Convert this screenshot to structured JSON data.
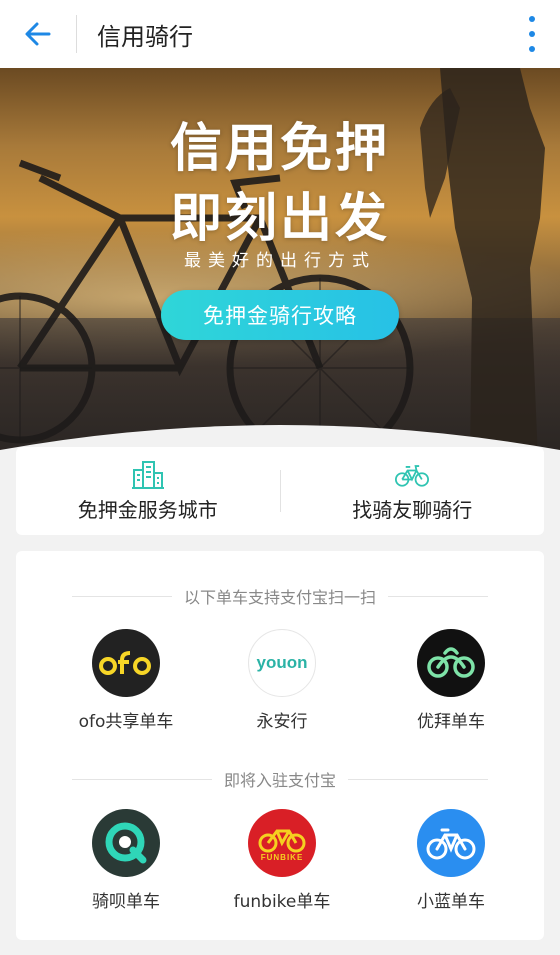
{
  "header": {
    "title": "信用骑行",
    "back_icon": "arrow-left-icon",
    "more_icon": "more-vertical-icon",
    "accent": "#1e88e5"
  },
  "banner": {
    "title_line1": "信用免押",
    "title_line2": "即刻出发",
    "subtitle": "最美好的出行方式",
    "button_label": "免押金骑行攻略",
    "button_color": "#2fd6d8"
  },
  "quick_links": [
    {
      "label": "免押金服务城市",
      "icon": "city-buildings-icon"
    },
    {
      "label": "找骑友聊骑行",
      "icon": "bicycle-icon"
    }
  ],
  "sections": [
    {
      "heading": "以下单车支持支付宝扫一扫",
      "apps": [
        {
          "name": "ofo共享单车",
          "logo_text": "ofo",
          "logo_bg": "#222222",
          "logo_fg": "#f7d627"
        },
        {
          "name": "永安行",
          "logo_text": "youon",
          "logo_bg": "#ffffff",
          "logo_fg": "#2bb3a6"
        },
        {
          "name": "优拜单车",
          "logo_text": "",
          "logo_bg": "#111111",
          "logo_fg": "#7ee3a8"
        }
      ]
    },
    {
      "heading": "即将入驻支付宝",
      "apps": [
        {
          "name": "骑呗单车",
          "logo_text": "",
          "logo_bg": "#2a3a36",
          "logo_fg": "#2fd6b8"
        },
        {
          "name": "funbike单车",
          "logo_text": "FUNBIKE",
          "logo_bg": "#d91f26",
          "logo_fg": "#f5d020"
        },
        {
          "name": "小蓝单车",
          "logo_text": "",
          "logo_bg": "#2a8ef0",
          "logo_fg": "#ffffff"
        }
      ]
    }
  ]
}
